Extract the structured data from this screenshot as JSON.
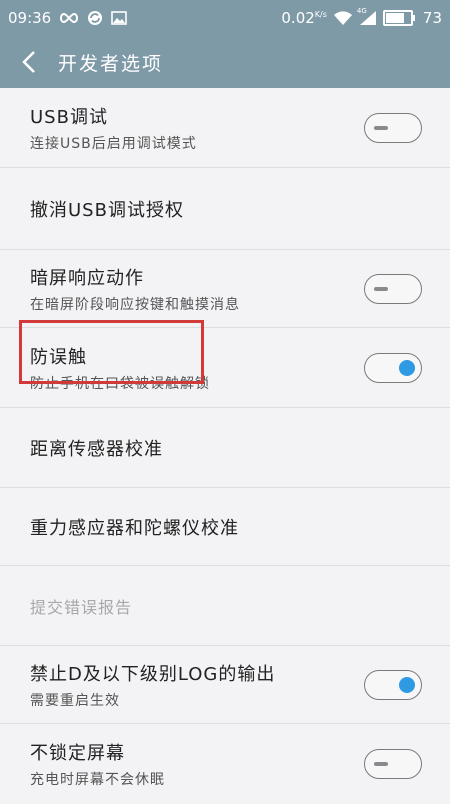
{
  "status_bar": {
    "time": "09:36",
    "net_speed": "0.02",
    "net_unit": "K/s",
    "network_type": "4G",
    "battery_level": "73",
    "icons": [
      "infinity-icon",
      "sync-icon",
      "image-icon",
      "wifi-icon",
      "signal-icon",
      "battery-icon"
    ]
  },
  "header": {
    "title": "开发者选项",
    "back_icon": "chevron-left-icon"
  },
  "settings": [
    {
      "title": "USB调试",
      "subtitle": "连接USB后启用调试模式",
      "toggle": "off"
    },
    {
      "title": "撤消USB调试授权"
    },
    {
      "title": "暗屏响应动作",
      "subtitle": "在暗屏阶段响应按键和触摸消息",
      "toggle": "off"
    },
    {
      "title": "防误触",
      "subtitle": "防止手机在口袋被误触解锁",
      "toggle": "on"
    },
    {
      "title": "距离传感器校准"
    },
    {
      "title": "重力感应器和陀螺仪校准"
    },
    {
      "title": "提交错误报告",
      "disabled": true
    },
    {
      "title": "禁止D及以下级别LOG的输出",
      "subtitle": "需要重启生效",
      "toggle": "on"
    },
    {
      "title": "不锁定屏幕",
      "subtitle": "充电时屏幕不会休眠",
      "toggle": "off"
    }
  ],
  "colors": {
    "header_bg": "#7f9aa7",
    "toggle_on": "#2f9ae4",
    "highlight": "#d23a3a"
  }
}
